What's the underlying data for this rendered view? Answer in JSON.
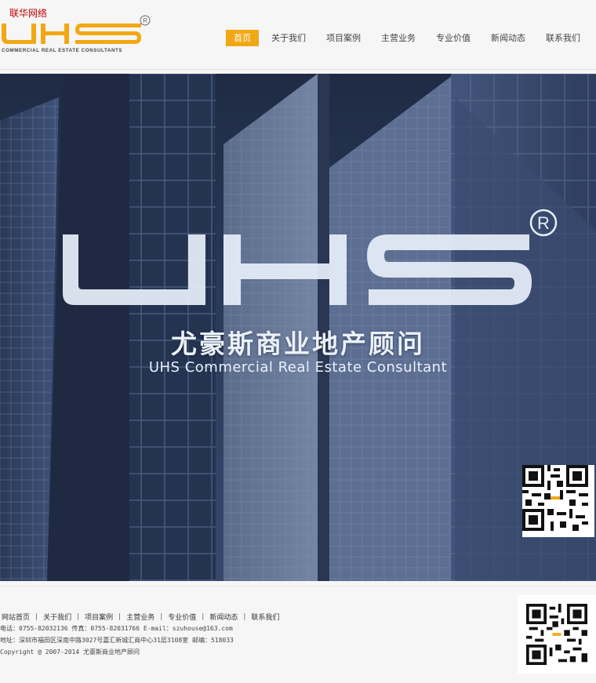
{
  "topnote": "联华网络",
  "brand": {
    "logo_text": "UHS",
    "logo_tagline": "COMMERCIAL REAL ESTATE CONSULTANTS",
    "registered_mark": "R",
    "accent": "#f2a814"
  },
  "nav": {
    "items": [
      {
        "label": "首页",
        "active": true
      },
      {
        "label": "关于我们"
      },
      {
        "label": "项目案例"
      },
      {
        "label": "主营业务"
      },
      {
        "label": "专业价值"
      },
      {
        "label": "新闻动态"
      },
      {
        "label": "联系我们"
      }
    ]
  },
  "banner": {
    "logo_text": "UHS",
    "title_cn": "尤豪斯商业地产顾问",
    "title_en": "UHS Commercial Real Estate Consultant",
    "qr_icon": "qr-code-icon"
  },
  "footer": {
    "links": [
      "网站首页",
      "关于我们",
      "项目案例",
      "主营业务",
      "专业价值",
      "新闻动态",
      "联系我们"
    ],
    "separator": "|",
    "contact": "电话：0755-82032136 传真：0755-82031766 E-mail：szuhouse@163.com",
    "address": "地址：深圳市福田区深南中路3027号嘉汇新城汇商中心31层3108室 邮编：518033",
    "copyright": "Copyright @ 2007-2014 尤豪斯商业地产顾问",
    "qr_icon": "qr-code-icon"
  }
}
